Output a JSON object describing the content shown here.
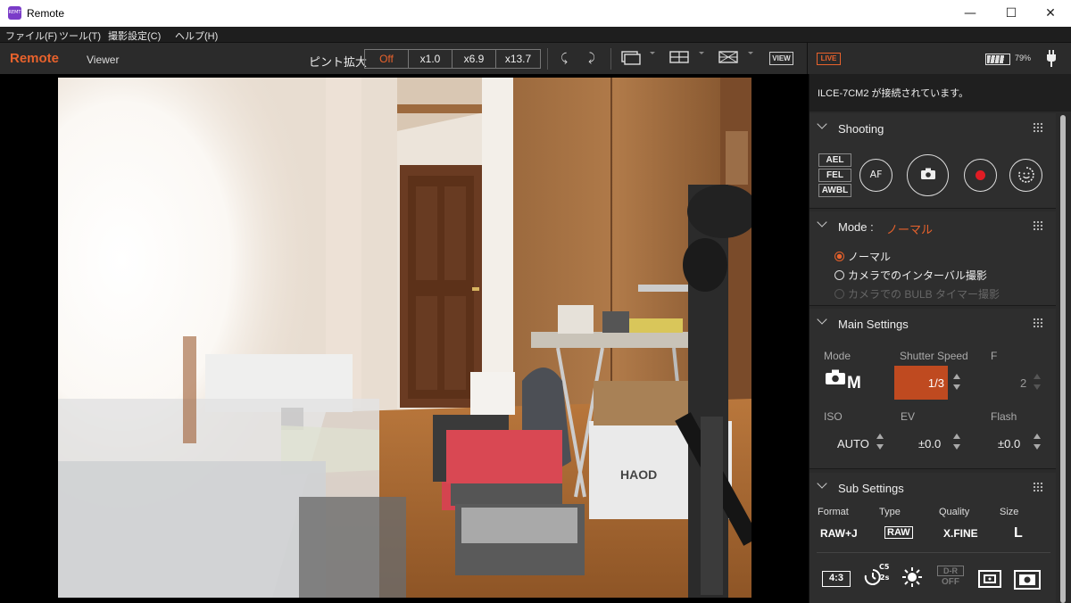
{
  "window": {
    "title": "Remote",
    "icon_text": "REMT",
    "minimize": "—",
    "maximize": "☐",
    "close": "✕"
  },
  "menu": [
    "ファイル(F)",
    "ツール(T)",
    "撮影設定(C)",
    "ヘルプ(H)"
  ],
  "toolbar": {
    "brand": "Remote",
    "viewer_tab": "Viewer",
    "focus_magnifier_label": "ピント拡大",
    "zoom_options": [
      "Off",
      "x1.0",
      "x6.9",
      "x13.7"
    ],
    "zoom_selected": "Off",
    "view_button": "VIEW",
    "live_button": "LIVE",
    "battery_percent": "79%",
    "battery_level": 0.79,
    "accent_color": "#e8622c"
  },
  "panel": {
    "connection_status": "ILCE-7CM2 が接続されています。",
    "shooting": {
      "title": "Shooting",
      "lock_buttons": [
        "AEL",
        "FEL",
        "AWBL"
      ],
      "af_button": "AF"
    },
    "mode": {
      "title": "Mode :",
      "current": "ノーマル",
      "options": [
        {
          "label": "ノーマル",
          "selected": true,
          "enabled": true
        },
        {
          "label": "カメラでのインターバル撮影",
          "selected": false,
          "enabled": true
        },
        {
          "label": "カメラでの BULB タイマー撮影",
          "selected": false,
          "enabled": false
        }
      ]
    },
    "main_settings": {
      "title": "Main Settings",
      "mode_label": "Mode",
      "mode_value": "M",
      "shutter_label": "Shutter Speed",
      "shutter_value": "1/3",
      "f_label": "F",
      "f_value": "2",
      "iso_label": "ISO",
      "iso_value": "AUTO",
      "ev_label": "EV",
      "ev_value": "±0.0",
      "flash_label": "Flash",
      "flash_value": "±0.0"
    },
    "sub_settings": {
      "title": "Sub Settings",
      "format_label": "Format",
      "format_value": "RAW+J",
      "type_label": "Type",
      "type_value": "RAW",
      "quality_label": "Quality",
      "quality_value": "X.FINE",
      "size_label": "Size",
      "size_value": "L",
      "aspect_value": "4:3",
      "drive_badge": "C5",
      "drive_sub": "2s",
      "dro_label": "D-R",
      "dro_value": "OFF"
    }
  }
}
